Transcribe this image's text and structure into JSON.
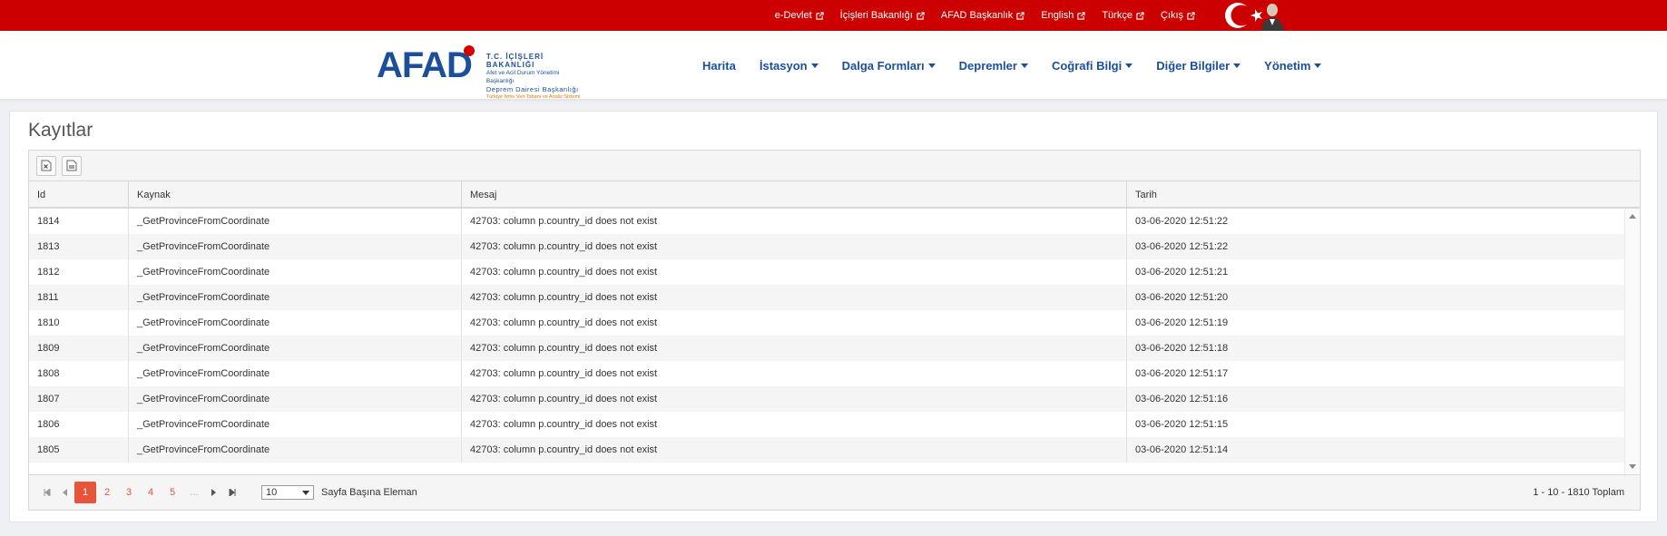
{
  "top_links": [
    {
      "label": "e-Devlet"
    },
    {
      "label": "İçişleri Bakanlığı"
    },
    {
      "label": "AFAD Başkanlık"
    },
    {
      "label": "English"
    },
    {
      "label": "Türkçe"
    },
    {
      "label": "Çıkış"
    }
  ],
  "logo": {
    "word": "AFAD",
    "line1": "T.C. İÇİŞLERİ BAKANLIĞI",
    "line2": "Afet ve Acil Durum Yönetimi Başkanlığı",
    "line3": "Deprem Dairesi Başkanlığı",
    "line4": "Türkiye İvme Veri Tabanı ve Analiz Sistemi"
  },
  "nav": [
    {
      "label": "Harita",
      "dropdown": false
    },
    {
      "label": "İstasyon",
      "dropdown": true
    },
    {
      "label": "Dalga Formları",
      "dropdown": true
    },
    {
      "label": "Depremler",
      "dropdown": true
    },
    {
      "label": "Coğrafi Bilgi",
      "dropdown": true
    },
    {
      "label": "Diğer Bilgiler",
      "dropdown": true
    },
    {
      "label": "Yönetim",
      "dropdown": true
    }
  ],
  "page": {
    "title": "Kayıtlar"
  },
  "table": {
    "columns": [
      "Id",
      "Kaynak",
      "Mesaj",
      "Tarih"
    ],
    "rows": [
      [
        "1814",
        "_GetProvinceFromCoordinate",
        "42703: column p.country_id does not exist",
        "03-06-2020 12:51:22"
      ],
      [
        "1813",
        "_GetProvinceFromCoordinate",
        "42703: column p.country_id does not exist",
        "03-06-2020 12:51:22"
      ],
      [
        "1812",
        "_GetProvinceFromCoordinate",
        "42703: column p.country_id does not exist",
        "03-06-2020 12:51:21"
      ],
      [
        "1811",
        "_GetProvinceFromCoordinate",
        "42703: column p.country_id does not exist",
        "03-06-2020 12:51:20"
      ],
      [
        "1810",
        "_GetProvinceFromCoordinate",
        "42703: column p.country_id does not exist",
        "03-06-2020 12:51:19"
      ],
      [
        "1809",
        "_GetProvinceFromCoordinate",
        "42703: column p.country_id does not exist",
        "03-06-2020 12:51:18"
      ],
      [
        "1808",
        "_GetProvinceFromCoordinate",
        "42703: column p.country_id does not exist",
        "03-06-2020 12:51:17"
      ],
      [
        "1807",
        "_GetProvinceFromCoordinate",
        "42703: column p.country_id does not exist",
        "03-06-2020 12:51:16"
      ],
      [
        "1806",
        "_GetProvinceFromCoordinate",
        "42703: column p.country_id does not exist",
        "03-06-2020 12:51:15"
      ],
      [
        "1805",
        "_GetProvinceFromCoordinate",
        "42703: column p.country_id does not exist",
        "03-06-2020 12:51:14"
      ]
    ]
  },
  "pager": {
    "pages": [
      "1",
      "2",
      "3",
      "4",
      "5",
      "..."
    ],
    "active_page": "1",
    "page_size": "10",
    "per_page_label": "Sayfa Başına Eleman",
    "summary": "1 - 10 - 1810 Toplam"
  },
  "colors": {
    "topbar": "#cc0000",
    "brand_blue": "#1b4f9c",
    "pager_accent": "#e8543a"
  }
}
